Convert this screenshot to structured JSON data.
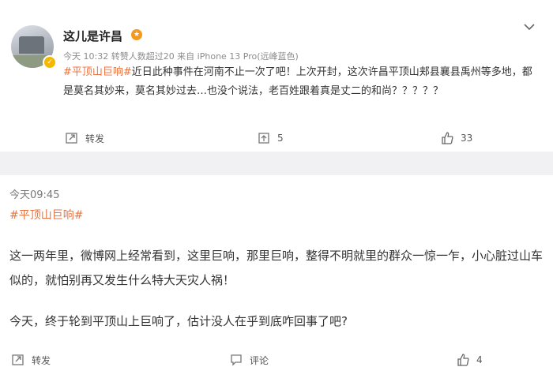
{
  "post1": {
    "username": "这儿是许昌",
    "meta": "今天 10:32 转赞人数超过20   来自 iPhone 13 Pro(远峰蓝色)",
    "hashtag": "#平顶山巨响#",
    "text": "近日此种事件在河南不止一次了吧！上次开封，这次许昌平顶山郏县襄县禹州等多地，都是莫名其妙来，莫名其妙过去…也没个说法，老百姓跟着真是丈二的和尚？？？？？",
    "repost_label": "转发",
    "comment_count": "5",
    "like_count": "33"
  },
  "post2": {
    "time": "今天09:45",
    "hashtag": "#平顶山巨响#",
    "paragraph1": "这一两年里，微博网上经常看到，这里巨响，那里巨响，整得不明就里的群众一惊一乍，小心脏过山车似的，就怕别再又发生什么特大天灾人祸！",
    "paragraph2": "今天，终于轮到平顶山上巨响了，估计没人在乎到底咋回事了吧?",
    "repost_label": "转发",
    "comment_label": "评论",
    "like_count": "4"
  },
  "icons": {
    "repost": "repost-icon",
    "comment": "comment-icon",
    "like": "thumbs-up-icon",
    "more": "chevron-down-icon",
    "verified": "verified-badge-icon",
    "gold": "gold-badge-icon"
  },
  "colors": {
    "hashtag": "#eb7340",
    "background": "#f1f1f3"
  }
}
